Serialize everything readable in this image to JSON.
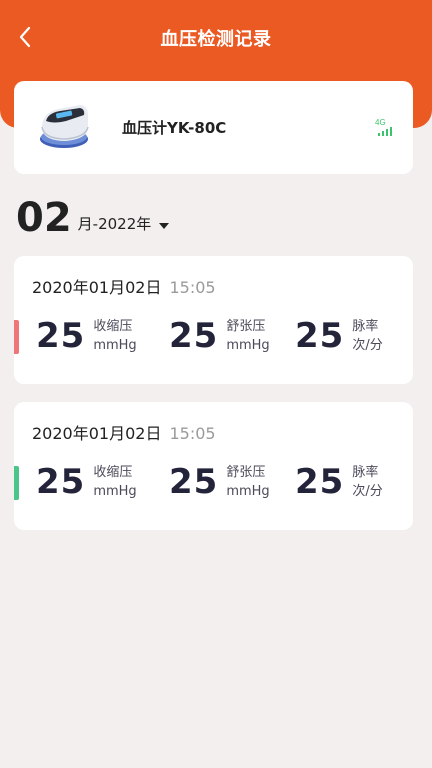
{
  "header": {
    "title": "血压检测记录",
    "back_icon": "chevron-left-icon"
  },
  "device": {
    "name": "血压计YK-80C",
    "network": "4G",
    "image_icon": "blood-pressure-monitor-icon"
  },
  "month": {
    "day": "02",
    "label": "月-2022年"
  },
  "records": [
    {
      "date": "2020年01月02日",
      "time": "15:05",
      "indicator_color": "#f0757a",
      "systolic": {
        "value": "25",
        "label": "收缩压",
        "unit": "mmHg"
      },
      "diastolic": {
        "value": "25",
        "label": "舒张压",
        "unit": "mmHg"
      },
      "pulse": {
        "value": "25",
        "label": "脉率",
        "unit": "次/分"
      }
    },
    {
      "date": "2020年01月02日",
      "time": "15:05",
      "indicator_color": "#4cc58b",
      "systolic": {
        "value": "25",
        "label": "收缩压",
        "unit": "mmHg"
      },
      "diastolic": {
        "value": "25",
        "label": "舒张压",
        "unit": "mmHg"
      },
      "pulse": {
        "value": "25",
        "label": "脉率",
        "unit": "次/分"
      }
    }
  ],
  "colors": {
    "accent": "#ec5a24",
    "background": "#f2efee",
    "signal": "#3cc46c"
  }
}
